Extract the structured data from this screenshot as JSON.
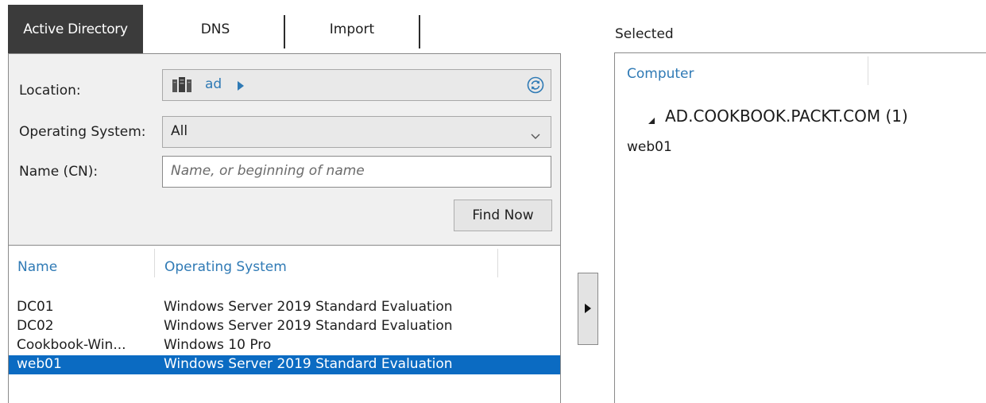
{
  "tabs": [
    {
      "label": "Active Directory",
      "active": true
    },
    {
      "label": "DNS",
      "active": false
    },
    {
      "label": "Import",
      "active": false
    }
  ],
  "search": {
    "location_label": "Location:",
    "location_value": "ad",
    "os_label": "Operating System:",
    "os_value": "All",
    "name_label": "Name (CN):",
    "name_placeholder": "Name, or beginning of name",
    "name_value": "",
    "find_button": "Find Now"
  },
  "results": {
    "columns": [
      "Name",
      "Operating System"
    ],
    "rows": [
      {
        "name": "DC01",
        "os": "Windows Server 2019 Standard Evaluation",
        "selected": false
      },
      {
        "name": "DC02",
        "os": "Windows Server 2019 Standard Evaluation",
        "selected": false
      },
      {
        "name": "Cookbook-Win...",
        "os": "Windows 10 Pro",
        "selected": false
      },
      {
        "name": "web01",
        "os": "Windows Server 2019 Standard Evaluation",
        "selected": true
      }
    ]
  },
  "selected_pane": {
    "label": "Selected",
    "column": "Computer",
    "group": "AD.COOKBOOK.PACKT.COM (1)",
    "items": [
      "web01"
    ]
  },
  "colors": {
    "accent_blue": "#2f7ab5",
    "selection": "#0b6bc2",
    "active_tab": "#3b3b3b",
    "panel_bg": "#f0f0f0"
  },
  "icons": {
    "location": "domain-server-icon",
    "breadcrumb": "triangle-right-icon",
    "refresh": "refresh-icon",
    "dropdown": "chevron-down-icon",
    "move": "move-right-icon",
    "tree_expand": "tree-expanded-icon"
  }
}
